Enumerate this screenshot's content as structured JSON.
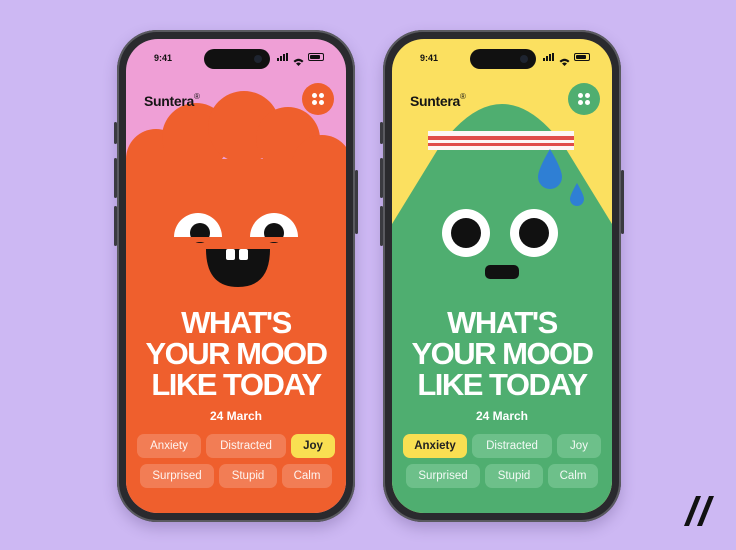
{
  "colors": {
    "background": "#cdb8f3",
    "phone1_top": "#ef9fd6",
    "phone1_main": "#ef5f2d",
    "phone1_chip": "#f27d55",
    "phone1_menu": "#ef5f2d",
    "phone2_top": "#fbe060",
    "phone2_main": "#4fae70",
    "phone2_chip": "#6dc08a",
    "phone2_menu": "#4fae70",
    "active_chip": "#f9df52"
  },
  "phones": [
    {
      "status": {
        "time": "9:41"
      },
      "brand": "Suntera",
      "brand_mark": "®",
      "menu_icon": "dots-grid-icon",
      "headline": [
        "WHAT'S",
        "YOUR MOOD",
        "LIKE TODAY"
      ],
      "date": "24 March",
      "moods": [
        [
          "Anxiety",
          "Distracted",
          "Joy"
        ],
        [
          "Surprised",
          "Stupid",
          "Calm"
        ]
      ],
      "selected_mood": "Joy"
    },
    {
      "status": {
        "time": "9:41"
      },
      "brand": "Suntera",
      "brand_mark": "®",
      "menu_icon": "dots-grid-icon",
      "headline": [
        "WHAT'S",
        "YOUR MOOD",
        "LIKE TODAY"
      ],
      "date": "24 March",
      "moods": [
        [
          "Anxiety",
          "Distracted",
          "Joy"
        ],
        [
          "Surprised",
          "Stupid",
          "Calm"
        ]
      ],
      "selected_mood": "Anxiety"
    }
  ],
  "corner_logo": "slash-logo-icon"
}
